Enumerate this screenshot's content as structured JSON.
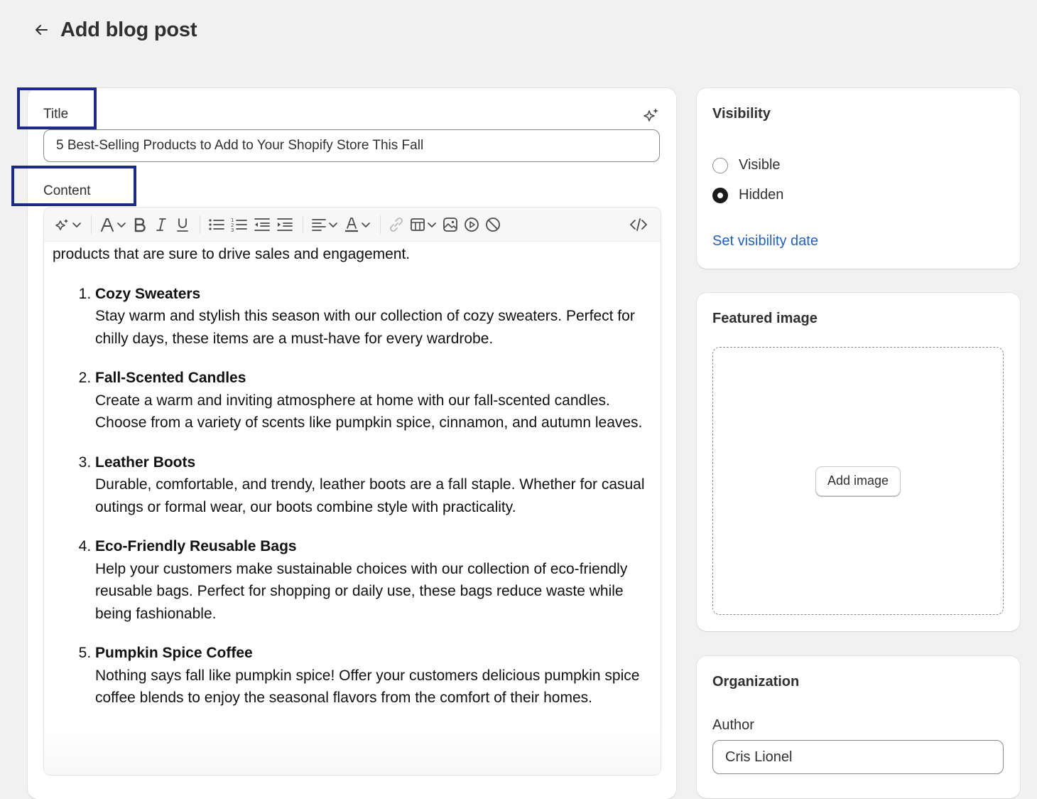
{
  "header": {
    "title": "Add blog post",
    "back_icon": "arrow-left-icon"
  },
  "main": {
    "title_label": "Title",
    "title_value": "5 Best-Selling Products to Add to Your Shopify Store This Fall",
    "content_label": "Content",
    "toolbar": [
      "magic-icon",
      "text-format-icon",
      "bold-icon",
      "italic-icon",
      "underline-icon",
      "bullet-list-icon",
      "numbered-list-icon",
      "outdent-icon",
      "indent-icon",
      "align-icon",
      "text-color-icon",
      "link-icon",
      "table-icon",
      "image-icon",
      "video-icon",
      "clear-format-icon",
      "code-icon"
    ],
    "content": {
      "intro": "products that are sure to drive sales and engagement.",
      "items": [
        {
          "title": "Cozy Sweaters",
          "body": "Stay warm and stylish this season with our collection of cozy sweaters. Perfect for chilly days, these items are a must-have for every wardrobe."
        },
        {
          "title": "Fall-Scented Candles",
          "body": "Create a warm and inviting atmosphere at home with our fall-scented candles. Choose from a variety of scents like pumpkin spice, cinnamon, and autumn leaves."
        },
        {
          "title": "Leather Boots",
          "body": "Durable, comfortable, and trendy, leather boots are a fall staple. Whether for casual outings or formal wear, our boots combine style with practicality."
        },
        {
          "title": "Eco-Friendly Reusable Bags",
          "body": "Help your customers make sustainable choices with our collection of eco-friendly reusable bags. Perfect for shopping or daily use, these bags reduce waste while being fashionable."
        },
        {
          "title": "Pumpkin Spice Coffee",
          "body": "Nothing says fall like pumpkin spice! Offer your customers delicious pumpkin spice coffee blends to enjoy the seasonal flavors from the comfort of their homes."
        }
      ]
    }
  },
  "visibility": {
    "title": "Visibility",
    "options": [
      {
        "label": "Visible",
        "checked": false
      },
      {
        "label": "Hidden",
        "checked": true
      }
    ],
    "link": "Set visibility date"
  },
  "featured_image": {
    "title": "Featured image",
    "button": "Add image"
  },
  "organization": {
    "title": "Organization",
    "author_label": "Author",
    "author_value": "Cris Lionel"
  },
  "colors": {
    "annotation": "#1b2a8c",
    "link": "#1f5fc9",
    "background": "#f1f1f1"
  }
}
